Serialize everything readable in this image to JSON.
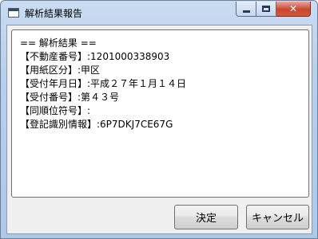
{
  "window": {
    "title": "解析結果報告"
  },
  "result_text": {
    "lines": [
      "== 解析結果 ==",
      "【不動産番号】:1201000338903",
      "【用紙区分】:甲区",
      "【受付年月日】:平成２７年１月１４日",
      "【受付番号】:第４３号",
      "【同順位符号】:",
      "【登記識別情報】:6P7DKJ7CE67G"
    ]
  },
  "buttons": {
    "ok_label": "決定",
    "cancel_label": "キャンセル"
  },
  "colors": {
    "titlebar": "#b8d0ec",
    "close_button": "#c8462e",
    "client_background": "#f0f0f0"
  },
  "icons": {
    "app": "window-app-icon",
    "minimize": "minimize-icon",
    "maximize": "maximize-icon",
    "close": "close-icon"
  }
}
